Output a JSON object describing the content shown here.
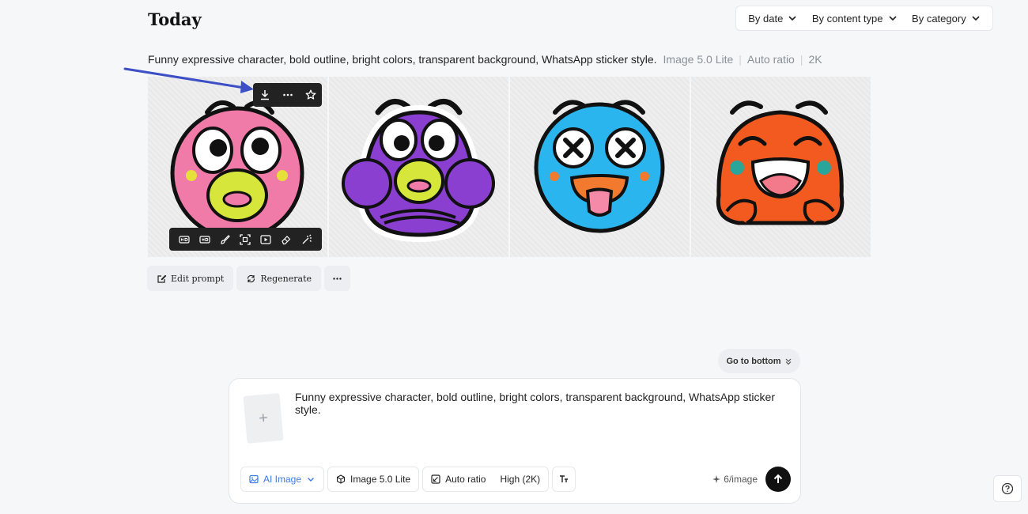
{
  "header": {
    "title": "Today"
  },
  "filters": [
    {
      "label": "By date"
    },
    {
      "label": "By content type"
    },
    {
      "label": "By category"
    }
  ],
  "generation": {
    "prompt": "Funny expressive character, bold outline, bright colors, transparent background, WhatsApp sticker style.",
    "model": "Image 5.0 Lite",
    "ratio": "Auto ratio",
    "resolution": "2K"
  },
  "actions": {
    "edit_prompt": "Edit prompt",
    "regenerate": "Regenerate"
  },
  "go_to_bottom": "Go to bottom",
  "composer": {
    "text": "Funny expressive character, bold outline, bright colors, transparent background, WhatsApp sticker style.",
    "mode": "AI Image",
    "model": "Image 5.0 Lite",
    "ratio": "Auto ratio",
    "quality": "High (2K)",
    "credits": "6/image"
  },
  "colors": {
    "accent": "#3b7be8",
    "arrow": "#3d4fc4",
    "toolbar": "#222222"
  }
}
